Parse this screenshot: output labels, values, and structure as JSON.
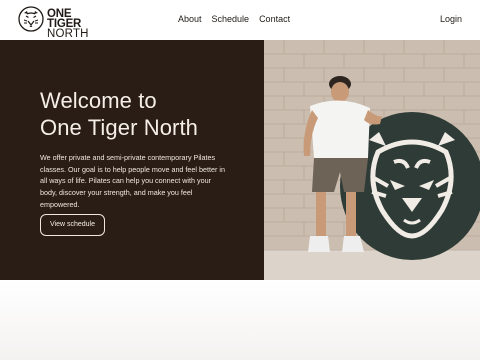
{
  "header": {
    "logo": {
      "line1": "ONE TIGER",
      "line2": "NORTH",
      "icon": "tiger-head-icon"
    },
    "nav": [
      "About",
      "Schedule",
      "Contact"
    ],
    "login_label": "Login"
  },
  "hero": {
    "title_line1": "Welcome to",
    "title_line2": "One Tiger North",
    "description": "We offer private and semi-private contemporary Pilates classes. Our goal is to help people move and feel better in all ways of life. Pilates can help you connect with your body, discover your strength, and make you feel empowered.",
    "cta_label": "View schedule",
    "image_icon": "tiger-emblem-icon"
  },
  "colors": {
    "hero_bg": "#2a1d15",
    "hero_text": "#f5efe8",
    "emblem_bg": "#2f3b37",
    "brick": "#c9bbad"
  }
}
